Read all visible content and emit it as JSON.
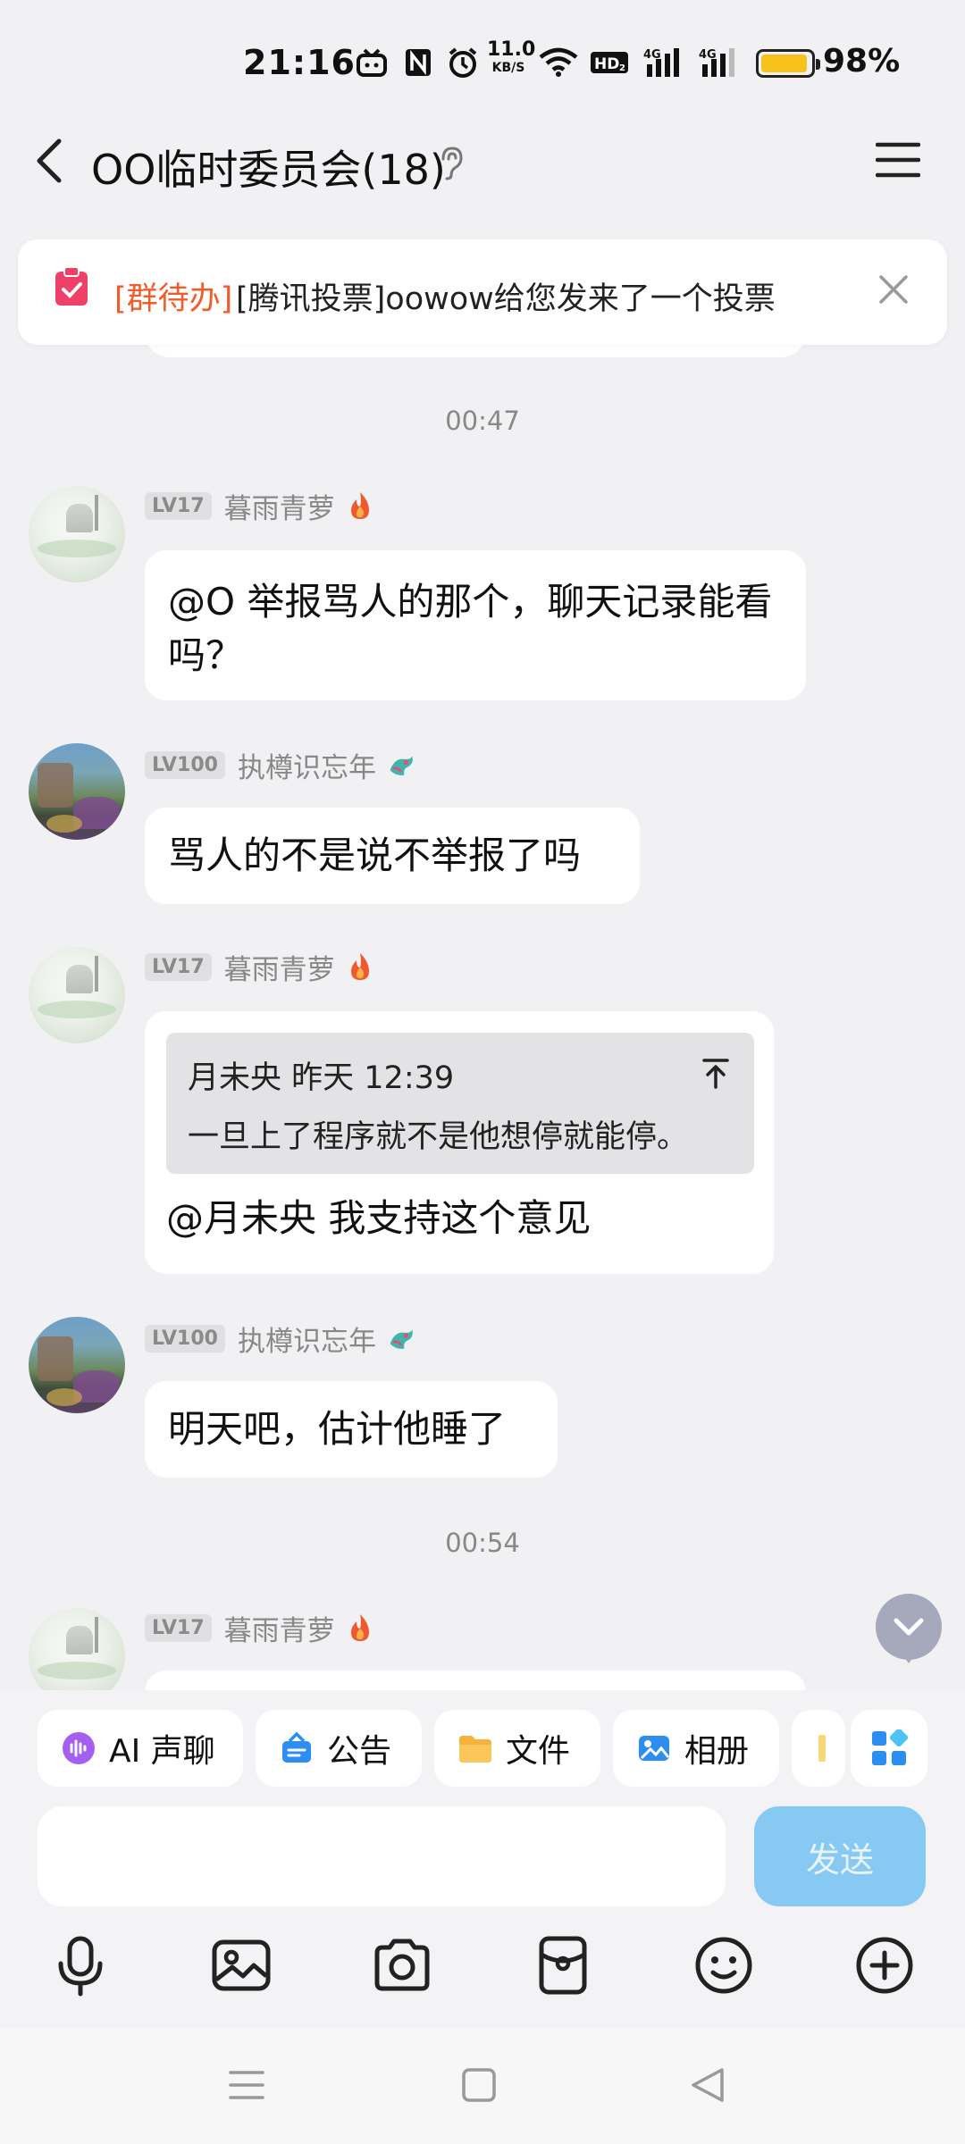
{
  "status_bar": {
    "time": "21:16",
    "net_speed_value": "11.0",
    "net_speed_unit": "KB/S",
    "battery_percent": "98%",
    "battery_level": 0.98,
    "battery_color": "#f7c21b"
  },
  "header": {
    "title": "OO临时委员会(18)"
  },
  "notice": {
    "tag": "[群待办]",
    "text": "[腾讯投票]oowow给您发来了一个投票",
    "tag_color": "#f25c2a"
  },
  "timestamps": [
    "00:47",
    "00:54"
  ],
  "messages": [
    {
      "level": "LV17",
      "sender": "暮雨青萝",
      "text": "@O 举报骂人的那个，聊天记录能看吗？"
    },
    {
      "level": "LV100",
      "sender": "执樽识忘年",
      "text": "骂人的不是说不举报了吗"
    },
    {
      "level": "LV17",
      "sender": "暮雨青萝",
      "quote": {
        "author": "月未央",
        "time": "昨天 12:39",
        "text": "一旦上了程序就不是他想停就能停。"
      },
      "text": "@月未央 我支持这个意见"
    },
    {
      "level": "LV100",
      "sender": "执樽识忘年",
      "text": "明天吧，估计他睡了"
    },
    {
      "level": "LV17",
      "sender": "暮雨青萝"
    }
  ],
  "quick_actions": [
    {
      "label": "AI 声聊",
      "icon": "ai-voice-icon"
    },
    {
      "label": "公告",
      "icon": "announcement-icon"
    },
    {
      "label": "文件",
      "icon": "folder-icon"
    },
    {
      "label": "相册",
      "icon": "album-icon"
    }
  ],
  "composer": {
    "input_value": "",
    "send_label": "发送",
    "send_color": "#88c9f3"
  },
  "toolbar_icons": [
    "microphone-icon",
    "image-icon",
    "camera-icon",
    "red-packet-icon",
    "emoji-icon",
    "plus-icon"
  ],
  "nav_icons": [
    "menu-nav-icon",
    "home-nav-icon",
    "back-nav-icon"
  ]
}
